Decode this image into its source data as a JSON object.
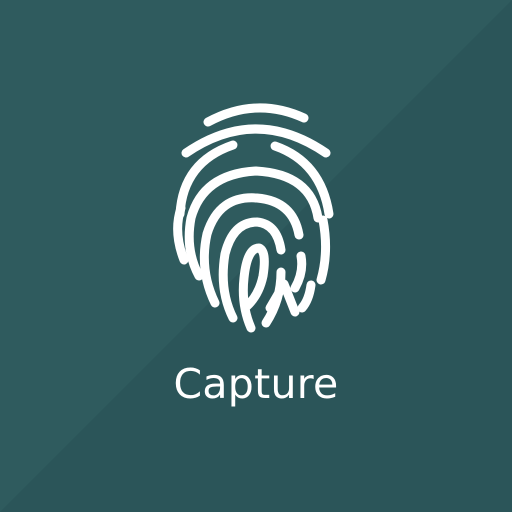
{
  "app_icon": {
    "label": "Capture",
    "icon": "fingerprint-icon",
    "colors": {
      "background": "#2f5b5e",
      "background_shadow": "#2b5559",
      "foreground": "#ffffff"
    }
  }
}
